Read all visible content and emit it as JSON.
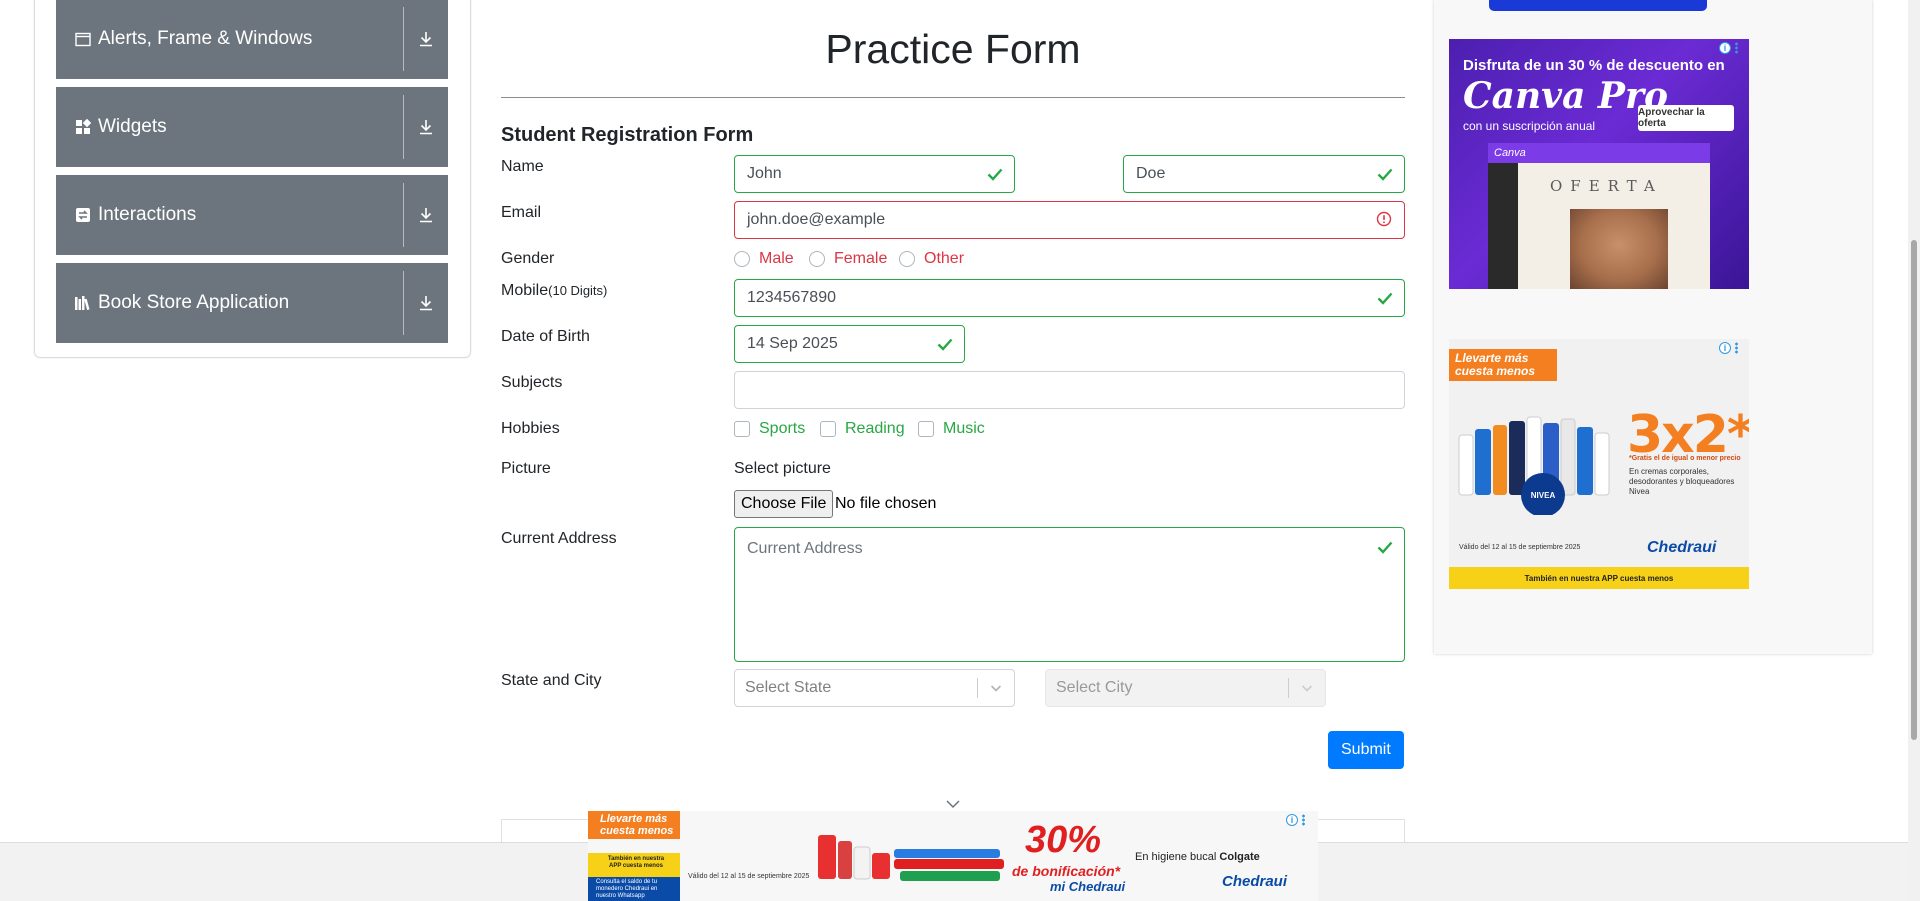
{
  "sidebar": {
    "items": [
      {
        "label": "Alerts, Frame & Windows",
        "icon": "window-icon"
      },
      {
        "label": "Widgets",
        "icon": "widgets-icon"
      },
      {
        "label": "Interactions",
        "icon": "interactions-icon"
      },
      {
        "label": "Book Store Application",
        "icon": "books-icon"
      }
    ]
  },
  "form": {
    "title": "Practice Form",
    "subtitle": "Student Registration Form",
    "labels": {
      "name": "Name",
      "email": "Email",
      "gender": "Gender",
      "mobile": "Mobile",
      "mobile_hint": "(10 Digits)",
      "dob": "Date of Birth",
      "subjects": "Subjects",
      "hobbies": "Hobbies",
      "picture": "Picture",
      "address": "Current Address",
      "state_city": "State and City"
    },
    "first_name": "John",
    "last_name": "Doe",
    "email": "john.doe@example",
    "gender_options": [
      "Male",
      "Female",
      "Other"
    ],
    "mobile": "1234567890",
    "dob": "14 Sep 2025",
    "subjects": "",
    "hobbies": [
      "Sports",
      "Reading",
      "Music"
    ],
    "picture_label": "Select picture",
    "file_button": "Choose File",
    "file_status": "No file chosen",
    "address_placeholder": "Current Address",
    "state_placeholder": "Select State",
    "city_placeholder": "Select City",
    "submit": "Submit"
  },
  "colors": {
    "valid": "#28a745",
    "invalid": "#dc3545",
    "primary": "#007bff",
    "sidebar": "#6c757d"
  },
  "ads": {
    "canva": {
      "headline": "Disfruta de un 30 % de descuento en",
      "brand": "Canva Pro",
      "sub": "con un suscripción anual",
      "cta": "Aprovechar la oferta",
      "mock_brand": "Canva",
      "mock_text": "OFERTA"
    },
    "chedraui_side": {
      "tag": "Llevarte más cuesta menos",
      "offer": "3x2*",
      "fine": "*Gratis el de igual o menor precio",
      "desc": "En cremas corporales, desodorantes y bloqueadores Nivea",
      "validity": "Válido del 12 al 15 de septiembre 2025",
      "brand": "Chedraui",
      "band": "También en nuestra APP cuesta menos"
    },
    "chedraui_bottom": {
      "tag": "Llevarte más cuesta menos",
      "app": "También en nuestra APP cuesta menos",
      "whatsapp": "Consulta el saldo de tu monedero Chedraui en nuestro Whatsapp",
      "validity": "Válido del 12 al 15 de septiembre 2025",
      "percent": "30%",
      "bonus": "de bonificación*",
      "mi": "mi Chedraui",
      "hygiene_prefix": "En higiene bucal",
      "hygiene_brand": "Colgate",
      "brand": "Chedraui"
    }
  }
}
